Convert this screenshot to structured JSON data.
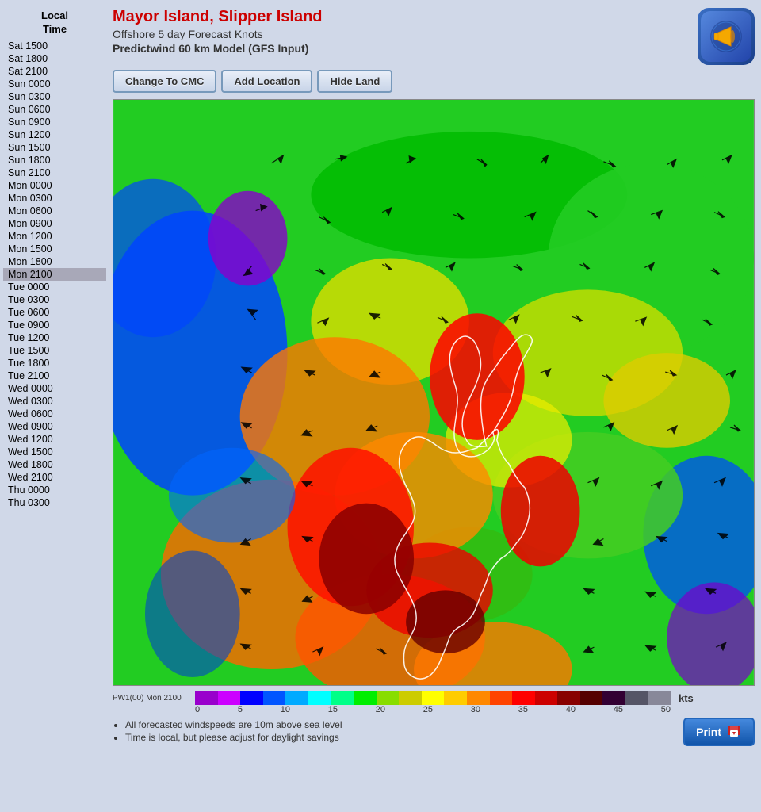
{
  "header": {
    "title": "Mayor Island, Slipper Island",
    "subtitle": "Offshore 5 day Forecast Knots",
    "model_label": "Predictwind 60 km Model (GFS Input)"
  },
  "toolbar": {
    "btn_cmc": "Change To CMC",
    "btn_add_location": "Add Location",
    "btn_hide_land": "Hide Land"
  },
  "sidebar": {
    "header_line1": "Local",
    "header_line2": "Time",
    "times": [
      "Sat 1500",
      "Sat 1800",
      "Sat 2100",
      "Sun 0000",
      "Sun 0300",
      "Sun 0600",
      "Sun 0900",
      "Sun 1200",
      "Sun 1500",
      "Sun 1800",
      "Sun 2100",
      "Mon 0000",
      "Mon 0300",
      "Mon 0600",
      "Mon 0900",
      "Mon 1200",
      "Mon 1500",
      "Mon 1800",
      "Mon 2100",
      "Tue 0000",
      "Tue 0300",
      "Tue 0600",
      "Tue 0900",
      "Tue 1200",
      "Tue 1500",
      "Tue 1800",
      "Tue 2100",
      "Wed 0000",
      "Wed 0300",
      "Wed 0600",
      "Wed 0900",
      "Wed 1200",
      "Wed 1500",
      "Wed 1800",
      "Wed 2100",
      "Thu 0000",
      "Thu 0300"
    ],
    "selected_index": 18
  },
  "legend": {
    "label": "PW1(00) Mon 2100",
    "segments": [
      {
        "color": "#9900cc",
        "label": ""
      },
      {
        "color": "#cc00ff",
        "label": ""
      },
      {
        "color": "#0000ff",
        "label": "5"
      },
      {
        "color": "#0055ff",
        "label": ""
      },
      {
        "color": "#00aaff",
        "label": "10"
      },
      {
        "color": "#00ffff",
        "label": ""
      },
      {
        "color": "#00ff88",
        "label": "15"
      },
      {
        "color": "#00ee00",
        "label": ""
      },
      {
        "color": "#88dd00",
        "label": "20"
      },
      {
        "color": "#cccc00",
        "label": ""
      },
      {
        "color": "#ffff00",
        "label": "25"
      },
      {
        "color": "#ffcc00",
        "label": ""
      },
      {
        "color": "#ff8800",
        "label": "30"
      },
      {
        "color": "#ff4400",
        "label": ""
      },
      {
        "color": "#ff0000",
        "label": "35"
      },
      {
        "color": "#cc0000",
        "label": ""
      },
      {
        "color": "#880000",
        "label": "40"
      },
      {
        "color": "#550000",
        "label": ""
      },
      {
        "color": "#330033",
        "label": "45"
      },
      {
        "color": "#555566",
        "label": ""
      },
      {
        "color": "#888899",
        "label": "50"
      }
    ],
    "scale_numbers": [
      "0",
      "5",
      "10",
      "15",
      "20",
      "25",
      "30",
      "35",
      "40",
      "45",
      "50"
    ],
    "kts": "kts"
  },
  "notes": [
    "All forecasted windspeeds are 10m above sea level",
    "Time is local, but please adjust for daylight savings"
  ],
  "print_btn": "Print"
}
